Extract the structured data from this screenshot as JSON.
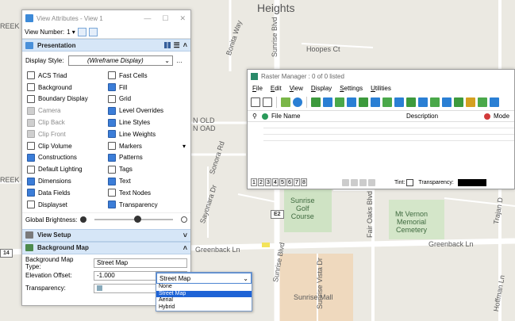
{
  "map": {
    "labels": {
      "heights": "Heights",
      "bonita_way": "Bonita Way",
      "hoopes_ct": "Hoopes Ct",
      "old_town": "N OLD\nN OAD",
      "sonora_rd": "Sonora Rd",
      "sayonara_dr": "Sayonara Dr",
      "sunrise_golf": "Sunrise\nGolf\nCourse",
      "mt_vernon": "Mt Vernon\nMemorial\nCemetery",
      "greenback_left": "Greenback Ln",
      "greenback_right": "Greenback Ln",
      "sunrise_blvd_top": "Sunrise Blvd",
      "sunrise_blvd_bottom": "Sunrise Blvd",
      "sunrise_vista": "Sunrise Vista Dr",
      "fair_oaks": "Fair Oaks Blvd",
      "trajan": "Trajan D",
      "hoffman": "Hoffman Ln",
      "sunrise_mall": "Sunrise Mall",
      "reek_top": "REEK",
      "reek_mid": "REEK",
      "e2": "E2",
      "r14": "14"
    }
  },
  "view_attributes": {
    "title": "View Attributes - View 1",
    "view_number_label": "View Number:",
    "view_number_value": "1",
    "presentation": {
      "header": "Presentation",
      "display_style_label": "Display Style:",
      "display_style_value": "(Wireframe Display)",
      "attributes_left": [
        {
          "label": "ACS Triad",
          "state": "plain"
        },
        {
          "label": "Background",
          "state": "plain"
        },
        {
          "label": "Boundary Display",
          "state": "plain"
        },
        {
          "label": "Camera",
          "state": "disabled"
        },
        {
          "label": "Clip Back",
          "state": "disabled"
        },
        {
          "label": "Clip Front",
          "state": "disabled"
        },
        {
          "label": "Clip Volume",
          "state": "plain"
        },
        {
          "label": "Constructions",
          "state": "on"
        },
        {
          "label": "Default Lighting",
          "state": "plain"
        },
        {
          "label": "Dimensions",
          "state": "on"
        },
        {
          "label": "Data Fields",
          "state": "on"
        },
        {
          "label": "Displayset",
          "state": "plain"
        }
      ],
      "attributes_right": [
        {
          "label": "Fast Cells",
          "state": "plain"
        },
        {
          "label": "Fill",
          "state": "on"
        },
        {
          "label": "Grid",
          "state": "plain"
        },
        {
          "label": "Level Overrides",
          "state": "on"
        },
        {
          "label": "Line Styles",
          "state": "on"
        },
        {
          "label": "Line Weights",
          "state": "on"
        },
        {
          "label": "Markers",
          "state": "plain"
        },
        {
          "label": "Patterns",
          "state": "on"
        },
        {
          "label": "Tags",
          "state": "plain"
        },
        {
          "label": "Text",
          "state": "on"
        },
        {
          "label": "Text Nodes",
          "state": "plain"
        },
        {
          "label": "Transparency",
          "state": "on"
        }
      ],
      "global_brightness_label": "Global Brightness:"
    },
    "view_setup": {
      "header": "View Setup"
    },
    "background_map": {
      "header": "Background Map",
      "type_label": "Background Map Type:",
      "type_value": "Street Map",
      "elevation_label": "Elevation Offset:",
      "elevation_value": "-1.000",
      "transparency_label": "Transparency:",
      "transparency_value": "0"
    }
  },
  "dropdown": {
    "current": "Street Map",
    "options": [
      "None",
      "Street Map",
      "Aerial",
      "Hybrid"
    ],
    "selected_index": 1
  },
  "raster_manager": {
    "title": "Raster Manager : 0 of 0 listed",
    "menus": [
      "File",
      "Edit",
      "View",
      "Display",
      "Settings",
      "Utilities"
    ],
    "columns": {
      "file_name": "File Name",
      "description": "Description",
      "mode": "Mode"
    },
    "view_buttons": [
      "1",
      "2",
      "3",
      "4",
      "5",
      "6",
      "7",
      "8"
    ],
    "tint_label": "Tint:",
    "transparency_label": "Transparency:"
  },
  "colors": {
    "accent": "#3b7dd8",
    "section_bg": "#d6e6f7",
    "dropdown_selected": "#1e63d6"
  }
}
